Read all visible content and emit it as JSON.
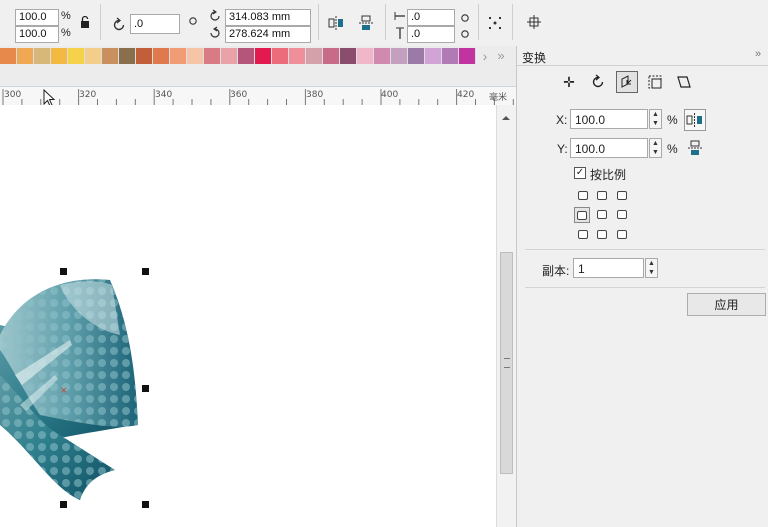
{
  "propbar": {
    "scale_x": "100.0",
    "scale_y": "100.0",
    "percent_symbol": "%",
    "rotation": ".0",
    "center_x": "314.083 mm",
    "center_y": "278.624 mm",
    "outline_x": ".0",
    "outline_y": ".0"
  },
  "palette": {
    "colors": [
      "#e7894b",
      "#f0a855",
      "#d8b87a",
      "#f4b942",
      "#f6d24a",
      "#f3ce8a",
      "#c8905e",
      "#8a6f4c",
      "#c05f3a",
      "#e07a4e",
      "#f29c75",
      "#f6c4a6",
      "#d87b84",
      "#e8a2a8",
      "#b4567a",
      "#e31a4f",
      "#ec6c7c",
      "#ef8f9a",
      "#d4a1aa",
      "#c86b89",
      "#8a4d6b",
      "#f2b6c9",
      "#d289b0",
      "#c3a0c0",
      "#9b7aa7",
      "#d2a3d6",
      "#b07ab5",
      "#c233a0"
    ],
    "scroll_right": "›",
    "scroll_more": "»"
  },
  "ruler": {
    "labels": [
      "300",
      "320",
      "340",
      "360",
      "380",
      "400",
      "420"
    ],
    "unit": "毫米"
  },
  "docker": {
    "title": "变换",
    "x_label": "X:",
    "x_value": "100.0",
    "y_label": "Y:",
    "y_value": "100.0",
    "percent": "%",
    "proportional_label": "按比例",
    "proportional_checked": true,
    "copies_label": "副本:",
    "copies_value": "1",
    "apply_label": "应用"
  }
}
